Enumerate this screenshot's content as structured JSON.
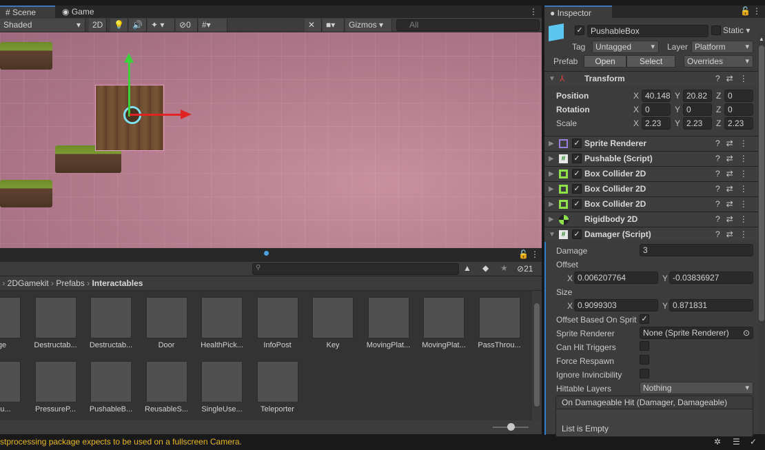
{
  "scene_panel": {
    "tabs": [
      {
        "label": "Scene",
        "icon": "hash-icon"
      },
      {
        "label": "Game",
        "icon": "gamepad-icon"
      }
    ],
    "toolbar": {
      "shading": "Shaded",
      "mode_2d": "2D",
      "hidden_count": "0",
      "gizmos": "Gizmos",
      "search_placeholder": "All"
    }
  },
  "project_panel": {
    "hidden_count": "21",
    "breadcrumb": [
      "2DGamekit",
      "Prefabs",
      "Interactables"
    ],
    "assets": [
      {
        "label": "dge",
        "row": 1
      },
      {
        "label": "Destructab...",
        "row": 1
      },
      {
        "label": "Destructab...",
        "row": 1
      },
      {
        "label": "Door",
        "row": 1
      },
      {
        "label": "HealthPick...",
        "row": 1
      },
      {
        "label": "InfoPost",
        "row": 1
      },
      {
        "label": "Key",
        "row": 1
      },
      {
        "label": "MovingPlat...",
        "row": 1
      },
      {
        "label": "MovingPlat...",
        "row": 1
      },
      {
        "label": "PassThrou...",
        "row": 1
      },
      {
        "label": "hrou...",
        "row": 2
      },
      {
        "label": "PressureP...",
        "row": 2
      },
      {
        "label": "PushableB...",
        "row": 2
      },
      {
        "label": "ReusableS...",
        "row": 2
      },
      {
        "label": "SingleUse...",
        "row": 2
      },
      {
        "label": "Teleporter",
        "row": 2
      }
    ],
    "zoom_slider": 0.5
  },
  "status_bar": {
    "message": "stprocessing package expects to be used on a fullscreen Camera.",
    "warning_color": "#e8b81a"
  },
  "inspector": {
    "title": "Inspector",
    "object_name": "PushableBox",
    "active": true,
    "static_label": "Static",
    "static": false,
    "tag_label": "Tag",
    "tag": "Untagged",
    "layer_label": "Layer",
    "layer": "Platform",
    "prefab_label": "Prefab",
    "open": "Open",
    "select": "Select",
    "overrides": "Overrides",
    "transform": {
      "title": "Transform",
      "position_label": "Position",
      "rotation_label": "Rotation",
      "scale_label": "Scale",
      "position": {
        "x": "40.148",
        "y": "20.82",
        "z": "0"
      },
      "rotation": {
        "x": "0",
        "y": "0",
        "z": "0"
      },
      "scale": {
        "x": "2.23",
        "y": "2.23",
        "z": "2.23"
      }
    },
    "components": [
      {
        "name": "Sprite Renderer",
        "enabled": true,
        "icon": "sprite-renderer-icon"
      },
      {
        "name": "Pushable (Script)",
        "enabled": true,
        "icon": "script-icon"
      },
      {
        "name": "Box Collider 2D",
        "enabled": true,
        "icon": "box-collider-icon"
      },
      {
        "name": "Box Collider 2D",
        "enabled": true,
        "icon": "box-collider-icon"
      },
      {
        "name": "Box Collider 2D",
        "enabled": true,
        "icon": "box-collider-icon"
      },
      {
        "name": "Rigidbody 2D",
        "enabled": null,
        "icon": "rigidbody-icon"
      },
      {
        "name": "Damager (Script)",
        "enabled": true,
        "icon": "script-icon",
        "expanded": true
      }
    ],
    "damager": {
      "damage_label": "Damage",
      "damage": "3",
      "offset_label": "Offset",
      "offset": {
        "x": "0.006207764",
        "y": "-0.03836927"
      },
      "size_label": "Size",
      "size": {
        "x": "0.9099303",
        "y": "0.871831"
      },
      "offset_sprite_label": "Offset Based On Sprit",
      "offset_sprite": true,
      "sprite_renderer_label": "Sprite Renderer",
      "sprite_renderer": "None (Sprite Renderer)",
      "can_hit_triggers_label": "Can Hit Triggers",
      "force_respawn_label": "Force Respawn",
      "ignore_invincibility_label": "Ignore Invincibility",
      "hittable_layers_label": "Hittable Layers",
      "hittable_layers": "Nothing",
      "event_title": "On Damageable Hit (Damager, Damageable)",
      "event_empty": "List is Empty"
    }
  }
}
